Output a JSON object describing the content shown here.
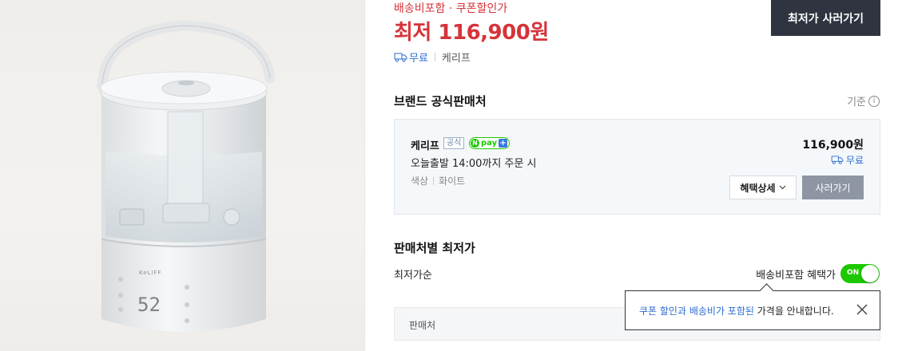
{
  "header": {
    "promo_text": "배송비포함 · 쿠폰할인가",
    "price_prefix": "최저",
    "price": "116,900원",
    "shipping_free": "무료",
    "seller": "케리프",
    "buy_button": "최저가 사러가기"
  },
  "brand_section": {
    "title": "브랜드 공식판매처",
    "basis_label": "기준",
    "card": {
      "seller_name": "케리프",
      "official_badge": "공식",
      "npay_n": "N",
      "npay_text": "pay",
      "npay_plus": "+",
      "delivery_text": "오늘출발 14:00까지 주문 시",
      "option_label": "색상",
      "option_value": "화이트",
      "price": "116,900원",
      "shipping": "무료",
      "benefit_button": "혜택상세",
      "buy_button": "사러가기"
    }
  },
  "seller_price_section": {
    "title": "판매처별 최저가",
    "sort_label": "최저가순",
    "toggle_label": "배송비포함 혜택가",
    "toggle_state": "ON",
    "table_header": "판매처"
  },
  "tooltip": {
    "highlight_text": "쿠폰 할인과 배송비가 포함된",
    "rest_text": " 가격을 안내합니다."
  },
  "product_display": {
    "brand_text": "KeLIFF",
    "display_digits": "52"
  },
  "colors": {
    "accent_red": "#d5343a",
    "link_blue": "#2e6cd1",
    "npay_green": "#1ec800",
    "dark_button": "#2f3440"
  }
}
